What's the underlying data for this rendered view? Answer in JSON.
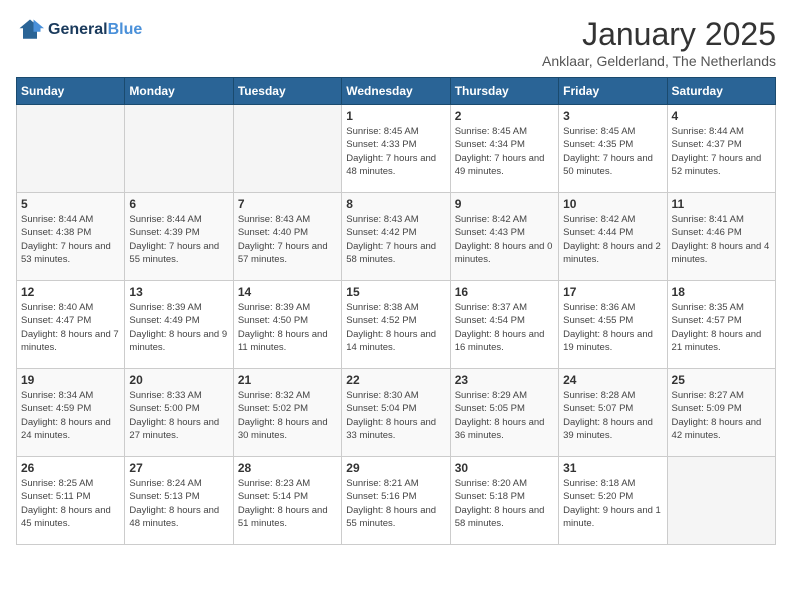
{
  "logo": {
    "line1": "General",
    "line2": "Blue"
  },
  "title": "January 2025",
  "location": "Anklaar, Gelderland, The Netherlands",
  "weekdays": [
    "Sunday",
    "Monday",
    "Tuesday",
    "Wednesday",
    "Thursday",
    "Friday",
    "Saturday"
  ],
  "weeks": [
    [
      {
        "day": "",
        "sunrise": "",
        "sunset": "",
        "daylight": "",
        "empty": true
      },
      {
        "day": "",
        "sunrise": "",
        "sunset": "",
        "daylight": "",
        "empty": true
      },
      {
        "day": "",
        "sunrise": "",
        "sunset": "",
        "daylight": "",
        "empty": true
      },
      {
        "day": "1",
        "sunrise": "Sunrise: 8:45 AM",
        "sunset": "Sunset: 4:33 PM",
        "daylight": "Daylight: 7 hours and 48 minutes.",
        "empty": false
      },
      {
        "day": "2",
        "sunrise": "Sunrise: 8:45 AM",
        "sunset": "Sunset: 4:34 PM",
        "daylight": "Daylight: 7 hours and 49 minutes.",
        "empty": false
      },
      {
        "day": "3",
        "sunrise": "Sunrise: 8:45 AM",
        "sunset": "Sunset: 4:35 PM",
        "daylight": "Daylight: 7 hours and 50 minutes.",
        "empty": false
      },
      {
        "day": "4",
        "sunrise": "Sunrise: 8:44 AM",
        "sunset": "Sunset: 4:37 PM",
        "daylight": "Daylight: 7 hours and 52 minutes.",
        "empty": false
      }
    ],
    [
      {
        "day": "5",
        "sunrise": "Sunrise: 8:44 AM",
        "sunset": "Sunset: 4:38 PM",
        "daylight": "Daylight: 7 hours and 53 minutes.",
        "empty": false
      },
      {
        "day": "6",
        "sunrise": "Sunrise: 8:44 AM",
        "sunset": "Sunset: 4:39 PM",
        "daylight": "Daylight: 7 hours and 55 minutes.",
        "empty": false
      },
      {
        "day": "7",
        "sunrise": "Sunrise: 8:43 AM",
        "sunset": "Sunset: 4:40 PM",
        "daylight": "Daylight: 7 hours and 57 minutes.",
        "empty": false
      },
      {
        "day": "8",
        "sunrise": "Sunrise: 8:43 AM",
        "sunset": "Sunset: 4:42 PM",
        "daylight": "Daylight: 7 hours and 58 minutes.",
        "empty": false
      },
      {
        "day": "9",
        "sunrise": "Sunrise: 8:42 AM",
        "sunset": "Sunset: 4:43 PM",
        "daylight": "Daylight: 8 hours and 0 minutes.",
        "empty": false
      },
      {
        "day": "10",
        "sunrise": "Sunrise: 8:42 AM",
        "sunset": "Sunset: 4:44 PM",
        "daylight": "Daylight: 8 hours and 2 minutes.",
        "empty": false
      },
      {
        "day": "11",
        "sunrise": "Sunrise: 8:41 AM",
        "sunset": "Sunset: 4:46 PM",
        "daylight": "Daylight: 8 hours and 4 minutes.",
        "empty": false
      }
    ],
    [
      {
        "day": "12",
        "sunrise": "Sunrise: 8:40 AM",
        "sunset": "Sunset: 4:47 PM",
        "daylight": "Daylight: 8 hours and 7 minutes.",
        "empty": false
      },
      {
        "day": "13",
        "sunrise": "Sunrise: 8:39 AM",
        "sunset": "Sunset: 4:49 PM",
        "daylight": "Daylight: 8 hours and 9 minutes.",
        "empty": false
      },
      {
        "day": "14",
        "sunrise": "Sunrise: 8:39 AM",
        "sunset": "Sunset: 4:50 PM",
        "daylight": "Daylight: 8 hours and 11 minutes.",
        "empty": false
      },
      {
        "day": "15",
        "sunrise": "Sunrise: 8:38 AM",
        "sunset": "Sunset: 4:52 PM",
        "daylight": "Daylight: 8 hours and 14 minutes.",
        "empty": false
      },
      {
        "day": "16",
        "sunrise": "Sunrise: 8:37 AM",
        "sunset": "Sunset: 4:54 PM",
        "daylight": "Daylight: 8 hours and 16 minutes.",
        "empty": false
      },
      {
        "day": "17",
        "sunrise": "Sunrise: 8:36 AM",
        "sunset": "Sunset: 4:55 PM",
        "daylight": "Daylight: 8 hours and 19 minutes.",
        "empty": false
      },
      {
        "day": "18",
        "sunrise": "Sunrise: 8:35 AM",
        "sunset": "Sunset: 4:57 PM",
        "daylight": "Daylight: 8 hours and 21 minutes.",
        "empty": false
      }
    ],
    [
      {
        "day": "19",
        "sunrise": "Sunrise: 8:34 AM",
        "sunset": "Sunset: 4:59 PM",
        "daylight": "Daylight: 8 hours and 24 minutes.",
        "empty": false
      },
      {
        "day": "20",
        "sunrise": "Sunrise: 8:33 AM",
        "sunset": "Sunset: 5:00 PM",
        "daylight": "Daylight: 8 hours and 27 minutes.",
        "empty": false
      },
      {
        "day": "21",
        "sunrise": "Sunrise: 8:32 AM",
        "sunset": "Sunset: 5:02 PM",
        "daylight": "Daylight: 8 hours and 30 minutes.",
        "empty": false
      },
      {
        "day": "22",
        "sunrise": "Sunrise: 8:30 AM",
        "sunset": "Sunset: 5:04 PM",
        "daylight": "Daylight: 8 hours and 33 minutes.",
        "empty": false
      },
      {
        "day": "23",
        "sunrise": "Sunrise: 8:29 AM",
        "sunset": "Sunset: 5:05 PM",
        "daylight": "Daylight: 8 hours and 36 minutes.",
        "empty": false
      },
      {
        "day": "24",
        "sunrise": "Sunrise: 8:28 AM",
        "sunset": "Sunset: 5:07 PM",
        "daylight": "Daylight: 8 hours and 39 minutes.",
        "empty": false
      },
      {
        "day": "25",
        "sunrise": "Sunrise: 8:27 AM",
        "sunset": "Sunset: 5:09 PM",
        "daylight": "Daylight: 8 hours and 42 minutes.",
        "empty": false
      }
    ],
    [
      {
        "day": "26",
        "sunrise": "Sunrise: 8:25 AM",
        "sunset": "Sunset: 5:11 PM",
        "daylight": "Daylight: 8 hours and 45 minutes.",
        "empty": false
      },
      {
        "day": "27",
        "sunrise": "Sunrise: 8:24 AM",
        "sunset": "Sunset: 5:13 PM",
        "daylight": "Daylight: 8 hours and 48 minutes.",
        "empty": false
      },
      {
        "day": "28",
        "sunrise": "Sunrise: 8:23 AM",
        "sunset": "Sunset: 5:14 PM",
        "daylight": "Daylight: 8 hours and 51 minutes.",
        "empty": false
      },
      {
        "day": "29",
        "sunrise": "Sunrise: 8:21 AM",
        "sunset": "Sunset: 5:16 PM",
        "daylight": "Daylight: 8 hours and 55 minutes.",
        "empty": false
      },
      {
        "day": "30",
        "sunrise": "Sunrise: 8:20 AM",
        "sunset": "Sunset: 5:18 PM",
        "daylight": "Daylight: 8 hours and 58 minutes.",
        "empty": false
      },
      {
        "day": "31",
        "sunrise": "Sunrise: 8:18 AM",
        "sunset": "Sunset: 5:20 PM",
        "daylight": "Daylight: 9 hours and 1 minute.",
        "empty": false
      },
      {
        "day": "",
        "sunrise": "",
        "sunset": "",
        "daylight": "",
        "empty": true
      }
    ]
  ]
}
